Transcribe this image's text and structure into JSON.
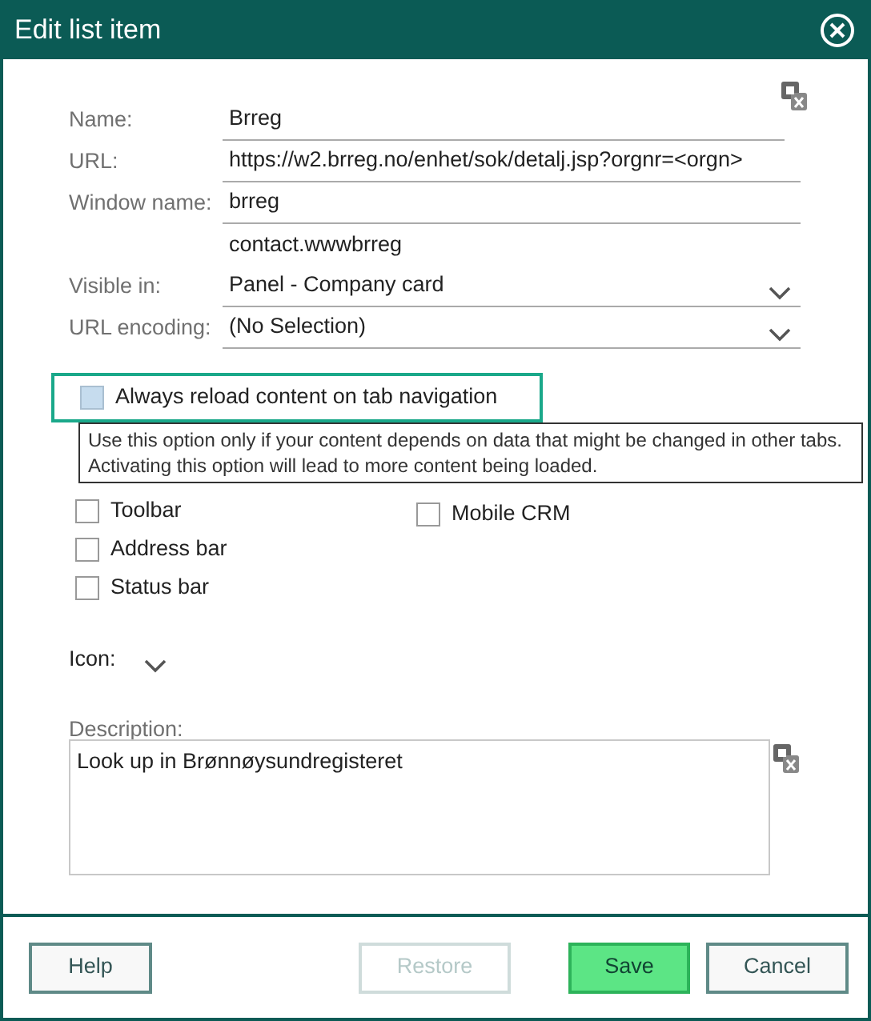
{
  "window": {
    "title": "Edit list item"
  },
  "fields": [
    {
      "kind": "text",
      "label": "Name:",
      "value": "Brreg",
      "translate": true
    },
    {
      "kind": "text",
      "label": "URL:",
      "value": "https://w2.brreg.no/enhet/sok/detalj.jsp?orgnr=<orgn>"
    },
    {
      "kind": "text",
      "label": "Window name:",
      "value": "brreg"
    },
    {
      "kind": "note",
      "value": "contact.wwwbrreg"
    },
    {
      "kind": "select",
      "label": "Visible in:",
      "value": "Panel - Company card"
    },
    {
      "kind": "select",
      "label": "URL encoding:",
      "value": "(No Selection)"
    }
  ],
  "reload_option": {
    "label": "Always reload content on tab navigation",
    "checked": false,
    "focused": true
  },
  "tooltip": "Use this option only if your content depends on data that might be changed in other tabs.\nActivating this option will lead to more content being loaded.",
  "options_left": [
    {
      "label": "Toolbar",
      "checked": false
    },
    {
      "label": "Address bar",
      "checked": false
    },
    {
      "label": "Status bar",
      "checked": false
    }
  ],
  "options_right": [
    {
      "label": "Mobile CRM",
      "checked": false
    }
  ],
  "icon_label": "Icon:",
  "description": {
    "label": "Description:",
    "value": "Look up in Brønnøysundregisteret"
  },
  "buttons": [
    {
      "label": "Help",
      "kind": "plain",
      "disabled": false
    },
    {
      "label": "Restore",
      "kind": "plain",
      "disabled": true
    },
    {
      "label": "Save",
      "kind": "primary",
      "disabled": false
    },
    {
      "label": "Cancel",
      "kind": "plain",
      "disabled": false
    }
  ]
}
